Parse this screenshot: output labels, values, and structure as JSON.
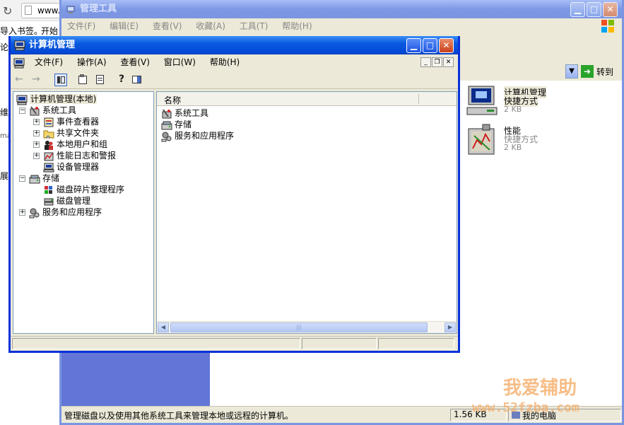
{
  "browser": {
    "url_fragment": "www.",
    "bookmark_text": "导入书签。",
    "start_text": "开始",
    "side_text_1": "论坛",
    "side_text_2": "维解",
    "side_text_3": "ma",
    "side_text_4": "展能"
  },
  "admin_tools": {
    "title": "管理工具",
    "menu": [
      "文件(F)",
      "编辑(E)",
      "查看(V)",
      "收藏(A)",
      "工具(T)",
      "帮助(H)"
    ],
    "go_label": "转到",
    "files": [
      {
        "name": "计算机管理",
        "type": "快捷方式",
        "size": "2 KB"
      },
      {
        "name": "性能",
        "type": "快捷方式",
        "size": "2 KB"
      }
    ],
    "status_text": "管理磁盘以及使用其他系统工具来管理本地或远程的计算机。",
    "status_size": "1.56 KB",
    "status_zone": "我的电脑"
  },
  "compmgmt": {
    "title": "计算机管理",
    "menu": [
      "文件(F)",
      "操作(A)",
      "查看(V)",
      "窗口(W)",
      "帮助(H)"
    ],
    "tree": {
      "root": "计算机管理(本地)",
      "system_tools": "系统工具",
      "event_viewer": "事件查看器",
      "shared_folders": "共享文件夹",
      "local_users": "本地用户和组",
      "perf_logs": "性能日志和警报",
      "device_manager": "设备管理器",
      "storage": "存储",
      "defrag": "磁盘碎片整理程序",
      "disk_mgmt": "磁盘管理",
      "services_apps": "服务和应用程序"
    },
    "list_header": "名称",
    "list_items": [
      "系统工具",
      "存储",
      "服务和应用程序"
    ]
  },
  "watermark": {
    "line1": "我爱辅助",
    "line2": "www.52fzba.com"
  },
  "colors": {
    "xp_blue": "#0831d9",
    "title_active": "#0a5ae0",
    "face": "#ece9d8"
  }
}
